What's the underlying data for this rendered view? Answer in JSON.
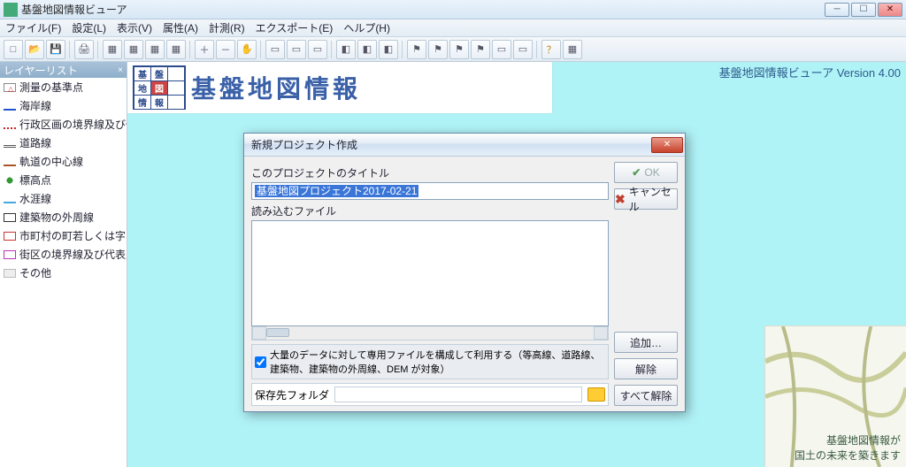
{
  "app": {
    "title": "基盤地図情報ビューア"
  },
  "menu": {
    "file": "ファイル(F)",
    "settings": "設定(L)",
    "view": "表示(V)",
    "attr": "属性(A)",
    "measure": "計測(R)",
    "export": "エクスポート(E)",
    "help": "ヘルプ(H)"
  },
  "sidebar": {
    "title": "レイヤーリスト",
    "items": [
      "測量の基準点",
      "海岸線",
      "行政区画の境界線及び代表点",
      "道路線",
      "軌道の中心線",
      "標高点",
      "水涯線",
      "建築物の外周線",
      "市町村の町若しくは字の境…",
      "街区の境界線及び代表点",
      "その他"
    ]
  },
  "banner": {
    "logo_chars": [
      "基",
      "盤",
      "地",
      "図",
      "情",
      "報"
    ],
    "title": "基盤地図情報"
  },
  "version": "基盤地図情報ビューア Version 4.00",
  "preview": {
    "line1": "基盤地図情報が",
    "line2": "国土の未来を築きます"
  },
  "dialog": {
    "title": "新規プロジェクト作成",
    "label_title": "このプロジェクトのタイトル",
    "title_value": "基盤地図プロジェクト2017-02-21",
    "label_files": "読み込むファイル",
    "ok": "OK",
    "cancel": "キャンセル",
    "add": "追加…",
    "remove": "解除",
    "remove_all": "すべて解除",
    "largefile_check": "大量のデータに対して専用ファイルを構成して利用する（等高線、道路線、建築物、建築物の外周線、DEM が対象）",
    "save_folder_label": "保存先フォルダ",
    "save_folder_value": ""
  }
}
